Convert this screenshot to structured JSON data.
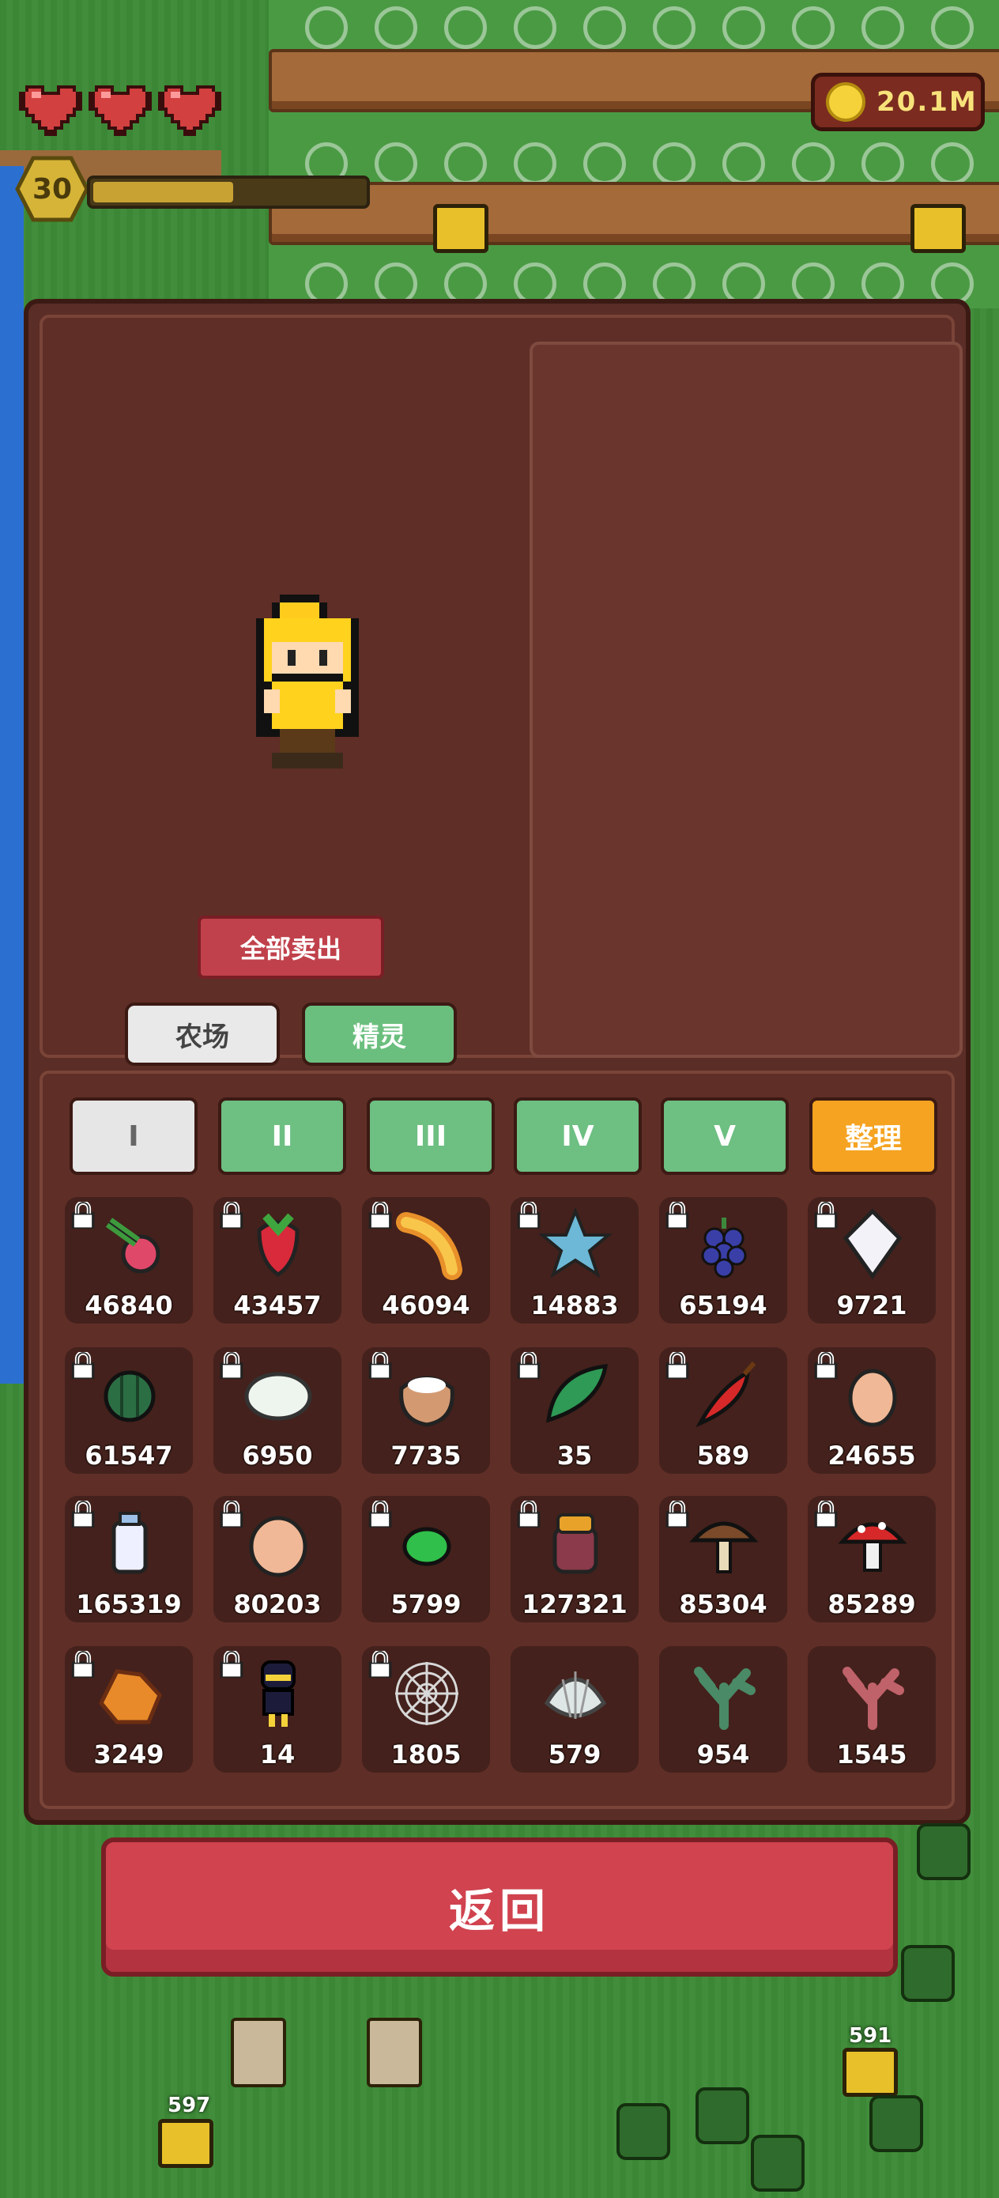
{
  "hud": {
    "hearts": 3,
    "level": "30",
    "xp_fraction": 0.52,
    "coins": "20.1M"
  },
  "panel": {
    "sell_all_label": "全部卖出",
    "mode_tabs": [
      {
        "label": "农场",
        "active": true
      },
      {
        "label": "精灵",
        "active": false
      }
    ],
    "tier_tabs": [
      {
        "label": "I",
        "active": true
      },
      {
        "label": "II",
        "active": false
      },
      {
        "label": "III",
        "active": false
      },
      {
        "label": "IV",
        "active": false
      },
      {
        "label": "V",
        "active": false
      }
    ],
    "sort_label": "整理",
    "items": [
      {
        "icon": "beet-icon",
        "count": "46840",
        "locked": true
      },
      {
        "icon": "radish-icon",
        "count": "43457",
        "locked": true
      },
      {
        "icon": "wheat-icon",
        "count": "46094",
        "locked": true
      },
      {
        "icon": "starfruit-icon",
        "count": "14883",
        "locked": true
      },
      {
        "icon": "grape-icon",
        "count": "65194",
        "locked": true
      },
      {
        "icon": "white-egg-icon",
        "count": "9721",
        "locked": true
      },
      {
        "icon": "watermelon-icon",
        "count": "61547",
        "locked": true
      },
      {
        "icon": "wool-icon",
        "count": "6950",
        "locked": true
      },
      {
        "icon": "flour-sack-icon",
        "count": "7735",
        "locked": true
      },
      {
        "icon": "leaf-icon",
        "count": "35",
        "locked": true
      },
      {
        "icon": "chili-icon",
        "count": "589",
        "locked": true
      },
      {
        "icon": "brown-egg-icon",
        "count": "24655",
        "locked": true
      },
      {
        "icon": "milk-bottle-icon",
        "count": "165319",
        "locked": true
      },
      {
        "icon": "large-egg-icon",
        "count": "80203",
        "locked": true
      },
      {
        "icon": "green-gem-icon",
        "count": "5799",
        "locked": true
      },
      {
        "icon": "honey-jar-icon",
        "count": "127321",
        "locked": true
      },
      {
        "icon": "brown-mushroom-icon",
        "count": "85304",
        "locked": true
      },
      {
        "icon": "red-mushroom-icon",
        "count": "85289",
        "locked": true
      },
      {
        "icon": "honeycomb-icon",
        "count": "3249",
        "locked": true
      },
      {
        "icon": "ninja-figure-icon",
        "count": "14",
        "locked": true
      },
      {
        "icon": "spiderweb-icon",
        "count": "1805",
        "locked": true
      },
      {
        "icon": "shell-icon",
        "count": "579",
        "locked": false
      },
      {
        "icon": "green-coral-icon",
        "count": "954",
        "locked": false
      },
      {
        "icon": "red-coral-icon",
        "count": "1545",
        "locked": false
      }
    ]
  },
  "back_label": "返回",
  "ground_labels": [
    "591",
    "597"
  ],
  "colors": {
    "panel": "#5a2d26",
    "green_tab": "#6dbf82",
    "sort_tab": "#f5a321",
    "back_button": "#d0434f",
    "coin_text": "#f7e27a"
  }
}
